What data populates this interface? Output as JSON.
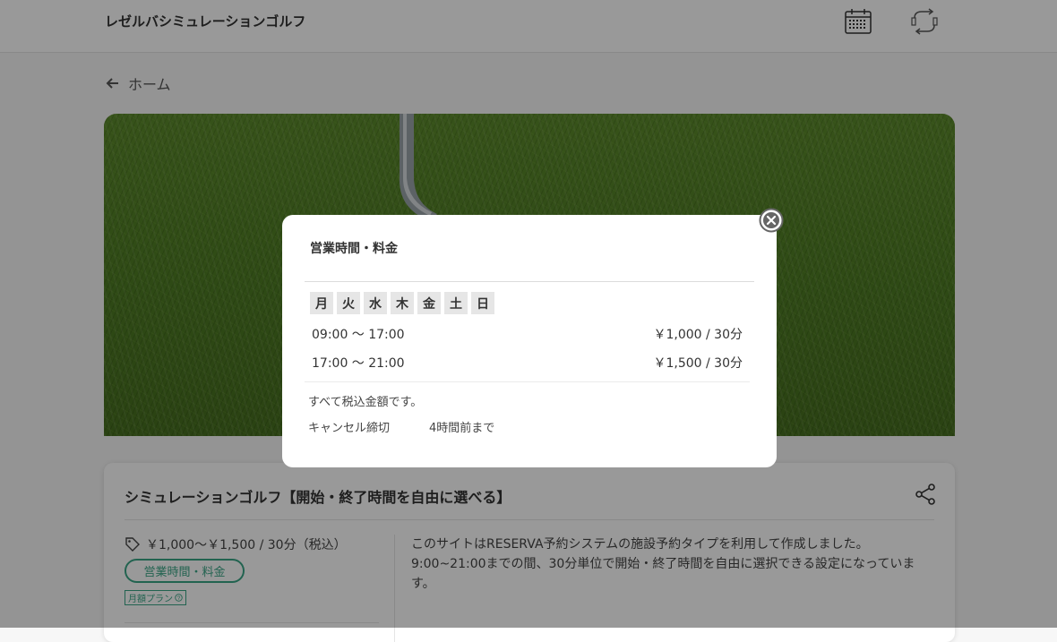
{
  "header": {
    "site_title": "レゼルバシミュレーションゴルフ",
    "icons": [
      "calendar-icon",
      "cycle-arrows-icon"
    ]
  },
  "nav": {
    "back_label": "ホーム"
  },
  "plan": {
    "title": "シミュレーションゴルフ【開始・終了時間を自由に選べる】",
    "price": "￥1,000〜￥1,500 / 30分（税込）",
    "hours_button": "営業時間・料金",
    "monthly_badge": "月額プラン",
    "description": "このサイトはRESERVA予約システムの施設予約タイプを利用して作成しました。\n9:00~21:00までの間、30分単位で開始・終了時間を自由に選択できる設定になっています。"
  },
  "modal": {
    "title": "営業時間・料金",
    "days": [
      "月",
      "火",
      "水",
      "木",
      "金",
      "土",
      "日"
    ],
    "slots": [
      {
        "time": "09:00 〜 17:00",
        "price": "￥1,000 / 30分"
      },
      {
        "time": "17:00 〜 21:00",
        "price": "￥1,500 / 30分"
      }
    ],
    "tax_note": "すべて税込金額です。",
    "cancel_label": "キャンセル締切",
    "cancel_value": "4時間前まで"
  },
  "colors": {
    "accent": "#3aa586",
    "overlay": "rgba(0,0,0,0.4)"
  }
}
